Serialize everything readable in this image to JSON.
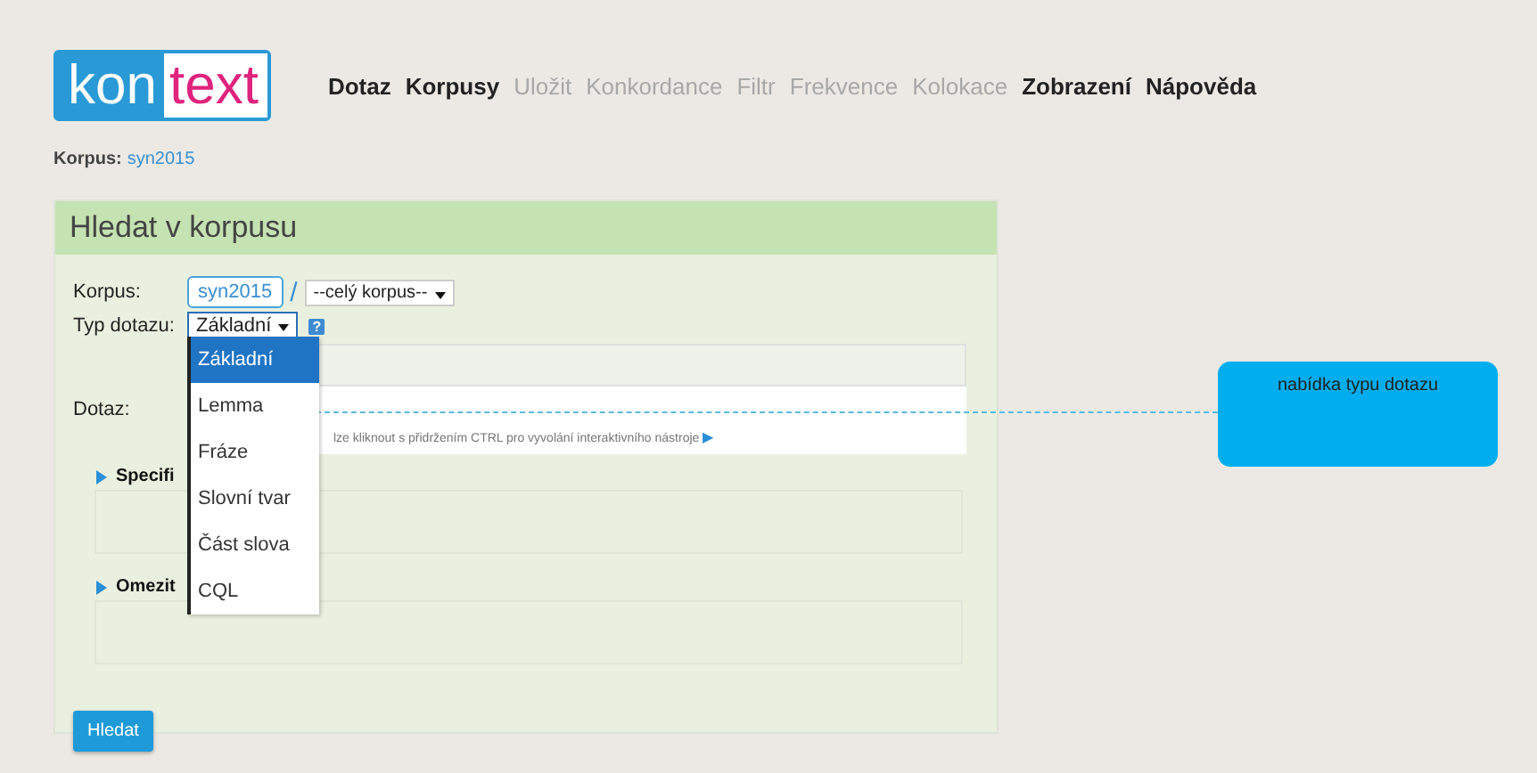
{
  "logo": {
    "part_1": "kon",
    "part_2": "text"
  },
  "nav": [
    {
      "label": "Dotaz",
      "disabled": false
    },
    {
      "label": "Korpusy",
      "disabled": false
    },
    {
      "label": "Uložit",
      "disabled": true
    },
    {
      "label": "Konkordance",
      "disabled": true
    },
    {
      "label": "Filtr",
      "disabled": true
    },
    {
      "label": "Frekvence",
      "disabled": true
    },
    {
      "label": "Kolokace",
      "disabled": true
    },
    {
      "label": "Zobrazení",
      "disabled": false
    },
    {
      "label": "Nápověda",
      "disabled": false
    }
  ],
  "breadcrumb": {
    "label": "Korpus:",
    "value": "syn2015"
  },
  "panel": {
    "title": "Hledat v korpusu",
    "corpus": {
      "label": "Korpus:",
      "value": "syn2015",
      "separator": "/",
      "subcorpus": "--celý korpus--"
    },
    "query_type": {
      "label": "Typ dotazu:",
      "value": "Základní",
      "help": "?",
      "options": [
        {
          "label": "Základní",
          "selected": true
        },
        {
          "label": "Lemma",
          "selected": false
        },
        {
          "label": "Fráze",
          "selected": false
        },
        {
          "label": "Slovní tvar",
          "selected": false
        },
        {
          "label": "Část slova",
          "selected": false
        },
        {
          "label": "CQL",
          "selected": false
        }
      ]
    },
    "query": {
      "label": "Dotaz:",
      "hint": "lze kliknout s přidržením CTRL pro vyvolání interaktivního nástroje",
      "hint_arrow": "▶"
    },
    "sections": [
      {
        "label": "Specifi",
        "expanded": false
      },
      {
        "label": "Omezit",
        "expanded": false
      }
    ],
    "submit": "Hledat"
  },
  "callout": {
    "text": "nabídka typu dotazu"
  }
}
